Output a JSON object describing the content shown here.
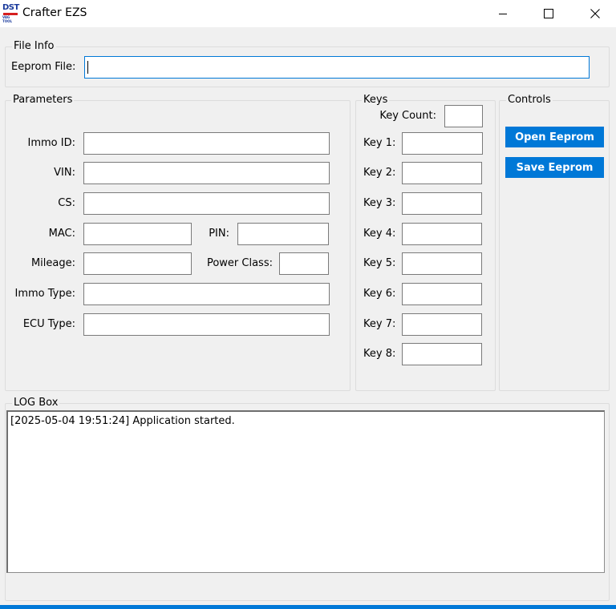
{
  "window": {
    "title": "Crafter EZS",
    "icon_text": "DST",
    "icon_subtext": "VAG TOOL"
  },
  "file_info": {
    "group_label": "File Info",
    "eeprom_file_label": "Eeprom File:",
    "eeprom_file_value": ""
  },
  "parameters": {
    "group_label": "Parameters",
    "immo_id_label": "Immo ID:",
    "vin_label": "VIN:",
    "cs_label": "CS:",
    "mac_label": "MAC:",
    "pin_label": "PIN:",
    "mileage_label": "Mileage:",
    "power_class_label": "Power Class:",
    "immo_type_label": "Immo Type:",
    "ecu_type_label": "ECU Type:"
  },
  "keys": {
    "group_label": "Keys",
    "key_count_label": "Key Count:",
    "labels": [
      "Key 1:",
      "Key 2:",
      "Key 3:",
      "Key 4:",
      "Key 5:",
      "Key 6:",
      "Key 7:",
      "Key 8:"
    ]
  },
  "controls": {
    "group_label": "Controls",
    "open_label": "Open Eeprom",
    "save_label": "Save Eeprom"
  },
  "log": {
    "group_label": "LOG Box",
    "lines": [
      "[2025-05-04 19:51:24] Application started."
    ]
  },
  "colors": {
    "accent": "#0078d7",
    "background": "#f0f0f0"
  }
}
